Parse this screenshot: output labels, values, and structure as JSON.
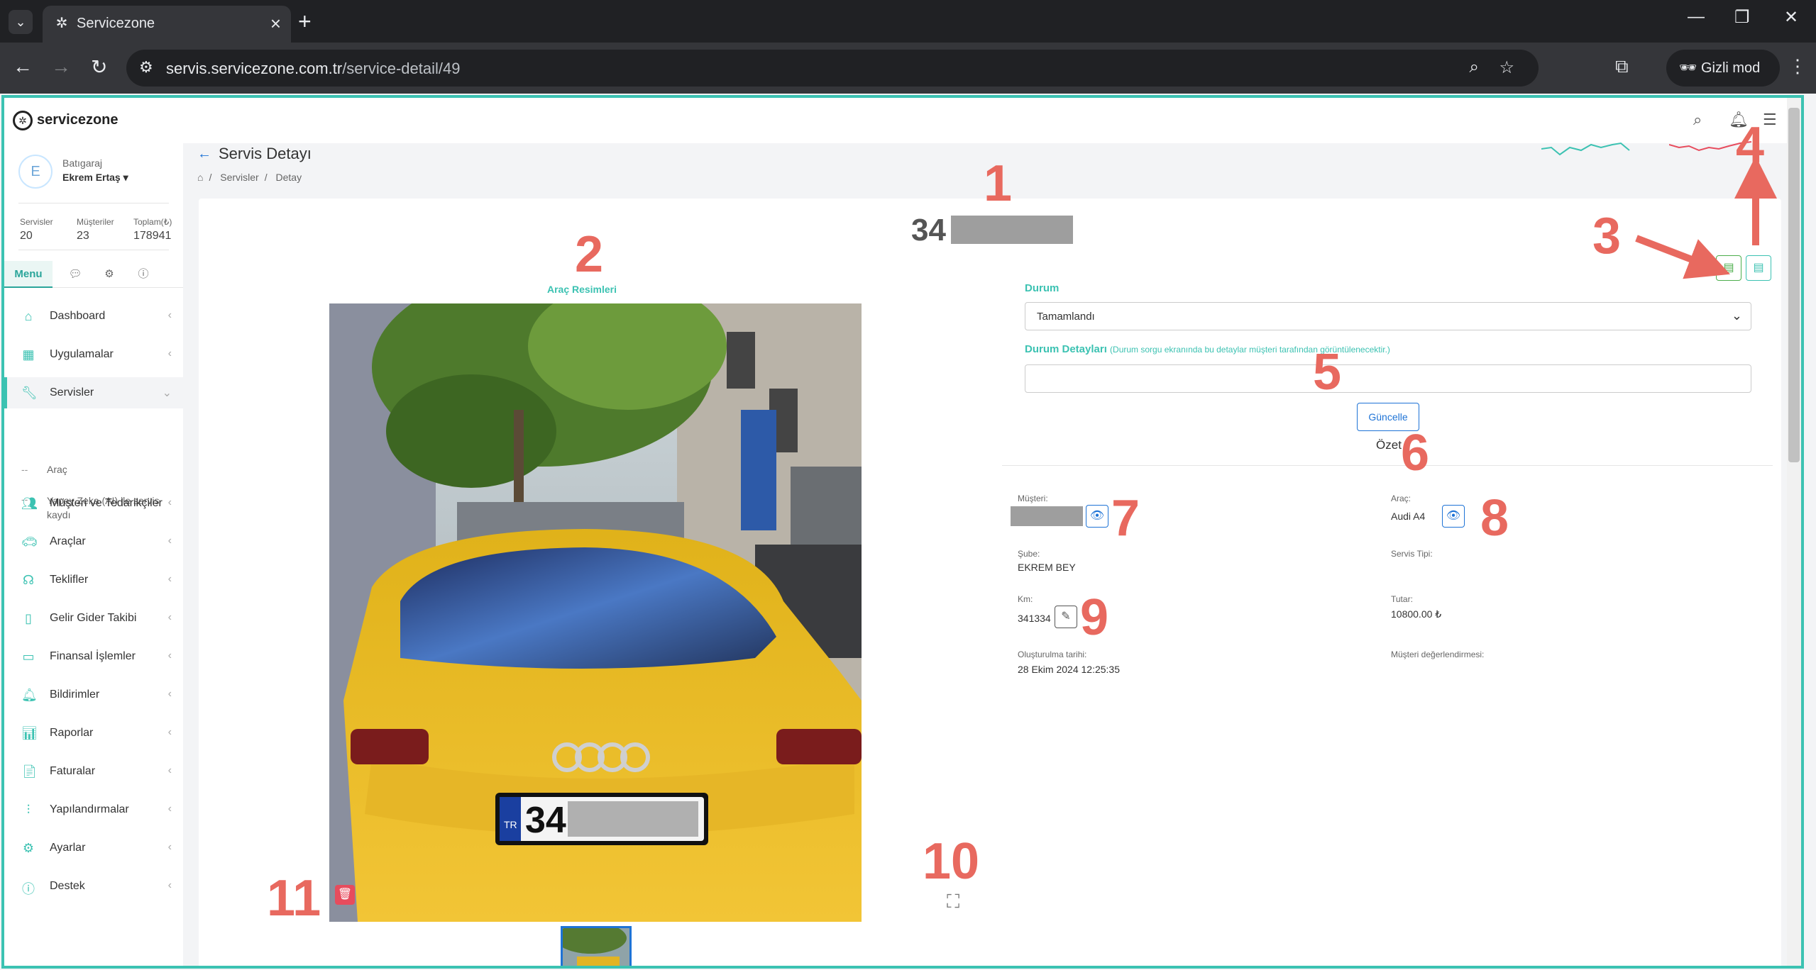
{
  "browser": {
    "tab_title": "Servicezone",
    "url_host": "servis.servicezone.com.tr",
    "url_path": "/service-detail/49",
    "incognito_label": "Gizli mod"
  },
  "app": {
    "logo_text": "servicezone"
  },
  "user": {
    "initial": "E",
    "org": "Batıgaraj",
    "name": "Ekrem Ertaş"
  },
  "stats": [
    {
      "label": "Servisler",
      "value": "20"
    },
    {
      "label": "Müşteriler",
      "value": "23"
    },
    {
      "label": "Toplam(₺)",
      "value": "178941"
    }
  ],
  "side_tabs": {
    "menu": "Menu"
  },
  "menu": [
    {
      "label": "Dashboard",
      "icon": "home-icon"
    },
    {
      "label": "Uygulamalar",
      "icon": "grid-icon"
    },
    {
      "label": "Servisler",
      "icon": "wrench-icon"
    },
    {
      "label": "Müşteri ve Tedarikçiler",
      "icon": "users-icon"
    },
    {
      "label": "Araçlar",
      "icon": "car-icon"
    },
    {
      "label": "Teklifler",
      "icon": "offer-icon"
    },
    {
      "label": "Gelir Gider Takibi",
      "icon": "book-icon"
    },
    {
      "label": "Finansal İşlemler",
      "icon": "folder-icon"
    },
    {
      "label": "Bildirimler",
      "icon": "bell-icon"
    },
    {
      "label": "Raporlar",
      "icon": "chart-icon"
    },
    {
      "label": "Faturalar",
      "icon": "file-icon"
    },
    {
      "label": "Yapılandırmalar",
      "icon": "sliders-icon"
    },
    {
      "label": "Ayarlar",
      "icon": "gear-icon"
    },
    {
      "label": "Destek",
      "icon": "info-icon"
    }
  ],
  "submenu": [
    {
      "label": "Araç"
    },
    {
      "label": "Yapay Zeka (AI) ile servis kaydı"
    }
  ],
  "page": {
    "title": "Servis Detayı",
    "breadcrumb": [
      "Servisler",
      "Detay"
    ]
  },
  "detail": {
    "plate_visible": "34",
    "gallery_title": "Araç Resimleri",
    "status_label": "Durum",
    "status_value": "Tamamlandı",
    "status_details_label": "Durum Detayları",
    "status_details_hint": "(Durum sorgu ekranında bu detaylar müşteri tarafından görüntülenecektir.)",
    "update_button": "Güncelle",
    "summary_title": "Özet",
    "customer_label": "Müşteri:",
    "vehicle_label": "Araç:",
    "vehicle_value": "Audi A4",
    "branch_label": "Şube:",
    "branch_value": "EKREM BEY",
    "service_type_label": "Servis Tipi:",
    "km_label": "Km:",
    "km_value": "341334",
    "amount_label": "Tutar:",
    "amount_value": "10800.00 ₺",
    "created_label": "Oluşturulma tarihi:",
    "created_value": "28 Ekim 2024 12:25:35",
    "rating_label": "Müşteri değerlendirmesi:"
  },
  "annotations": [
    "1",
    "2",
    "3",
    "4",
    "5",
    "6",
    "7",
    "8",
    "9",
    "10",
    "11"
  ],
  "colors": {
    "accent": "#3cc2b2",
    "primary": "#1e73d6",
    "danger": "#e74c5d",
    "annotation": "#e8695f"
  }
}
